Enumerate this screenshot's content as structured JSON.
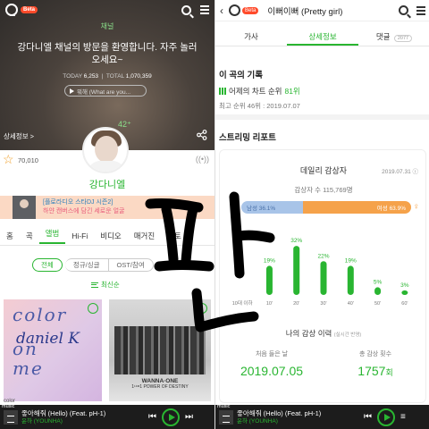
{
  "left": {
    "channel_label": "채널",
    "welcome": "강다니엘 채널의 방문을 환영합니다. 자주 놀러 오세요~",
    "stats": {
      "today_label": "TODAY",
      "today": "6,253",
      "total_label": "TOTAL",
      "total": "1,070,359"
    },
    "now_playing": "뭐해 (What are you...",
    "detail_link": "상세정보 >",
    "like_count": "42⁺",
    "fav_count": "70,010",
    "artist_name": "강다니엘",
    "banner": {
      "line1": "[플로라디오 스타DJ 시즌2]",
      "line2": "하얀 캔버스에 담긴 세로운 얼굴"
    },
    "tabs": [
      "홈",
      "곡",
      "앨범",
      "Hi-Fi",
      "비디오",
      "매거진",
      "포토"
    ],
    "active_tab": "앨범",
    "filters": [
      "전체",
      "정규/싱글",
      "OST/참여"
    ],
    "sort_label": "최신순",
    "album1": {
      "line1": "color",
      "line2": "on",
      "line3": "me",
      "signature": "daniel K"
    },
    "album1_mini": "color",
    "album2": {
      "title": "WANNA·ONE",
      "subtitle": "1¹¹=1 POWER OF DESTINY"
    }
  },
  "player": {
    "song": "좋아해줘 (Hello) (Feat. pH-1)",
    "artist": "윤하 (YOUNHA)",
    "mini_label": "music"
  },
  "right": {
    "title": "이뻐이뻐 (Pretty girl)",
    "tabs": [
      "가사",
      "상세정보",
      "댓글"
    ],
    "comment_count": "2077",
    "record_title": "이 곡의 기록",
    "chart_rank_prefix": "어제의 차트 순위",
    "chart_rank_value": "81위",
    "best_rank": "최고 순위 46위 : 2019.07.07",
    "streaming_title": "스트리밍 리포트",
    "daily_title": "데일리 감상자",
    "daily_date": "2019.07.31 ⓘ",
    "listeners": "감상자 수 115,769명",
    "male_label": "남성 36.1%",
    "female_label": "여성 63.9%",
    "male_pct": 36.1,
    "history_title": "나의 감상 이력",
    "history_note": "(실시간 반영)",
    "first_listen_label": "처음 들은 날",
    "first_listen_value": "2019.07.05",
    "total_plays_label": "총 감상 횟수",
    "total_plays_value": "1757",
    "total_plays_unit": "회"
  },
  "chart_data": {
    "type": "bar",
    "title": "데일리 감상자",
    "categories": [
      "10대 이하",
      "10'",
      "20'",
      "30'",
      "40'",
      "50'",
      "60'"
    ],
    "values": [
      0,
      19,
      32,
      22,
      19,
      5,
      3
    ],
    "value_labels": [
      "",
      "19%",
      "32%",
      "22%",
      "19%",
      "5%",
      "3%"
    ],
    "ylim": [
      0,
      35
    ],
    "color": "#29b531"
  },
  "overlay_text": "판",
  "colors": {
    "accent": "#29b531",
    "female": "#f5a24a",
    "male": "#a8c4e8"
  }
}
